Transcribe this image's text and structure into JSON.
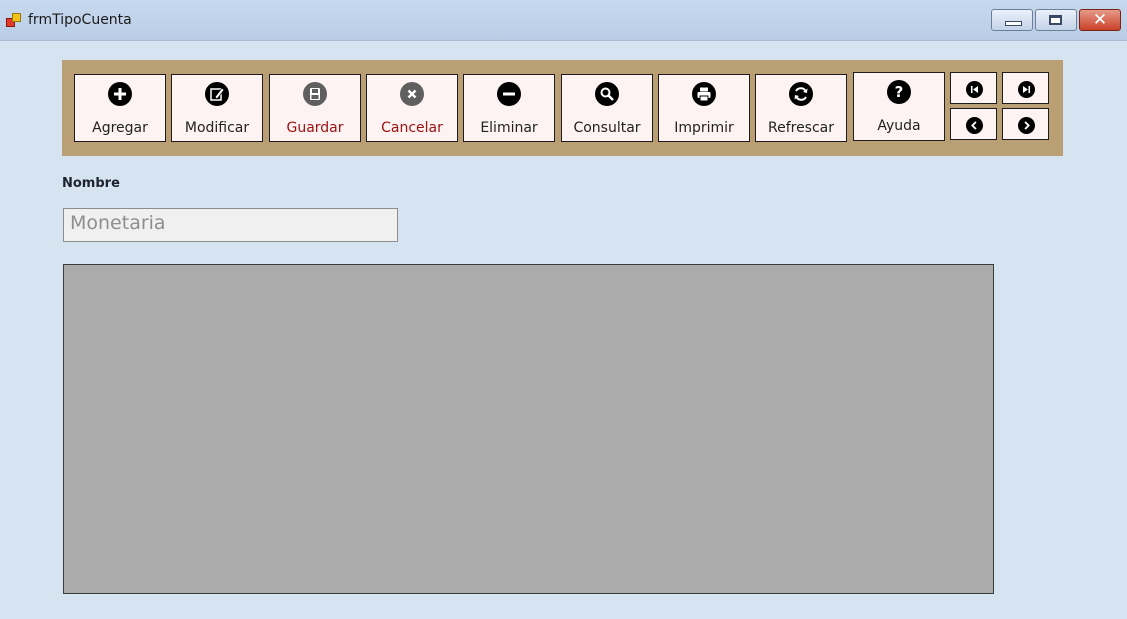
{
  "window": {
    "title": "frmTipoCuenta"
  },
  "toolbar": {
    "buttons": [
      {
        "label": "Agregar",
        "icon": "plus-circle-icon"
      },
      {
        "label": "Modificar",
        "icon": "edit-icon"
      },
      {
        "label": "Guardar",
        "icon": "save-icon"
      },
      {
        "label": "Cancelar",
        "icon": "cancel-icon"
      },
      {
        "label": "Eliminar",
        "icon": "minus-circle-icon"
      },
      {
        "label": "Consultar",
        "icon": "search-icon"
      },
      {
        "label": "Imprimir",
        "icon": "print-icon"
      },
      {
        "label": "Refrescar",
        "icon": "refresh-icon"
      },
      {
        "label": "Ayuda",
        "icon": "help-icon"
      }
    ],
    "navigation": [
      "first-record-icon",
      "last-record-icon",
      "previous-record-icon",
      "next-record-icon"
    ]
  },
  "form": {
    "nombre_label": "Nombre",
    "nombre_value": "Monetaria"
  },
  "colors": {
    "toolbar_bg": "#bb9f74",
    "disabled_label": "#9b1111",
    "form_bg": "#d6e3f1"
  }
}
